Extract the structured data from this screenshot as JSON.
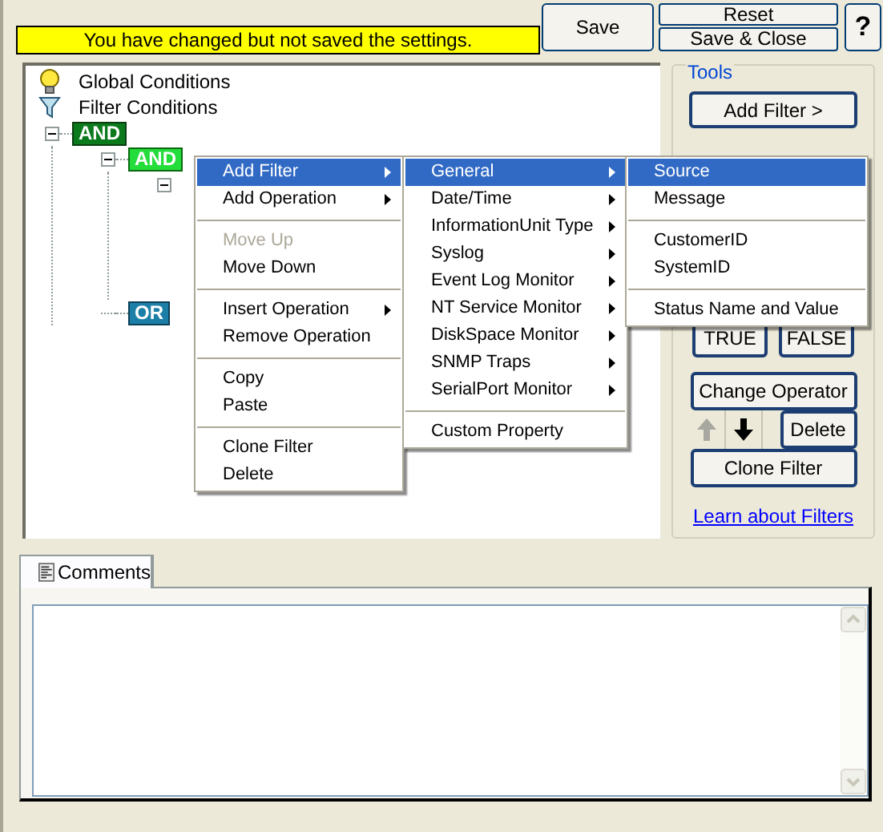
{
  "header": {
    "notice": "You have changed but not saved the settings.",
    "save": "Save",
    "reset": "Reset",
    "save_close": "Save & Close",
    "help": "?"
  },
  "tree": {
    "roots": [
      {
        "kind": "global",
        "label": "Global Conditions"
      },
      {
        "kind": "filter",
        "label": "Filter Conditions"
      }
    ],
    "operators": [
      {
        "kind": "and",
        "label": "AND",
        "expanded": true,
        "selected": false,
        "children": [
          {
            "kind": "and",
            "label": "AND",
            "expanded": true,
            "selected": true,
            "children": [
              {
                "kind": "hidden",
                "expanded": true
              }
            ]
          },
          {
            "kind": "or",
            "label": "OR",
            "selected": false
          }
        ]
      }
    ]
  },
  "tools": {
    "title": "Tools",
    "add_filter": "Add Filter >",
    "true_label": "TRUE",
    "false_label": "FALSE",
    "change_operator": "Change Operator",
    "arrows": [
      {
        "kind": "up",
        "disabled": true
      },
      {
        "kind": "down",
        "disabled": false
      }
    ],
    "delete": "Delete",
    "clone_filter": "Clone Filter",
    "link": "Learn about Filters"
  },
  "comments": {
    "tab": {
      "label": "Comments",
      "selected": true
    }
  },
  "menus": [
    {
      "items": [
        {
          "kind": "item",
          "label": "Add Filter",
          "submenu": true,
          "selected": true,
          "disabled": false
        },
        {
          "kind": "item",
          "label": "Add Operation",
          "submenu": true,
          "selected": false,
          "disabled": false
        },
        {
          "kind": "separator"
        },
        {
          "kind": "item",
          "label": "Move Up",
          "submenu": false,
          "selected": false,
          "disabled": true
        },
        {
          "kind": "item",
          "label": "Move Down",
          "submenu": false,
          "selected": false,
          "disabled": false
        },
        {
          "kind": "separator"
        },
        {
          "kind": "item",
          "label": "Insert Operation",
          "submenu": true,
          "selected": false,
          "disabled": false
        },
        {
          "kind": "item",
          "label": "Remove Operation",
          "submenu": false,
          "selected": false,
          "disabled": false
        },
        {
          "kind": "separator"
        },
        {
          "kind": "item",
          "label": "Copy",
          "submenu": false,
          "selected": false,
          "disabled": false
        },
        {
          "kind": "item",
          "label": "Paste",
          "submenu": false,
          "selected": false,
          "disabled": false
        },
        {
          "kind": "separator"
        },
        {
          "kind": "item",
          "label": "Clone Filter",
          "submenu": false,
          "selected": false,
          "disabled": false
        },
        {
          "kind": "item",
          "label": "Delete",
          "submenu": false,
          "selected": false,
          "disabled": false
        }
      ]
    },
    {
      "items": [
        {
          "kind": "item",
          "label": "General",
          "submenu": true,
          "selected": true,
          "disabled": false
        },
        {
          "kind": "item",
          "label": "Date/Time",
          "submenu": true,
          "selected": false,
          "disabled": false
        },
        {
          "kind": "item",
          "label": "InformationUnit Type",
          "submenu": true,
          "selected": false,
          "disabled": false
        },
        {
          "kind": "item",
          "label": "Syslog",
          "submenu": true,
          "selected": false,
          "disabled": false
        },
        {
          "kind": "item",
          "label": "Event Log Monitor",
          "submenu": true,
          "selected": false,
          "disabled": false
        },
        {
          "kind": "item",
          "label": "NT Service Monitor",
          "submenu": true,
          "selected": false,
          "disabled": false
        },
        {
          "kind": "item",
          "label": "DiskSpace Monitor",
          "submenu": true,
          "selected": false,
          "disabled": false
        },
        {
          "kind": "item",
          "label": "SNMP Traps",
          "submenu": true,
          "selected": false,
          "disabled": false
        },
        {
          "kind": "item",
          "label": "SerialPort Monitor",
          "submenu": true,
          "selected": false,
          "disabled": false
        },
        {
          "kind": "separator"
        },
        {
          "kind": "item",
          "label": "Custom Property",
          "submenu": false,
          "selected": false,
          "disabled": false
        }
      ]
    },
    {
      "items": [
        {
          "kind": "item",
          "label": "Source",
          "submenu": false,
          "selected": true,
          "disabled": false
        },
        {
          "kind": "item",
          "label": "Message",
          "submenu": false,
          "selected": false,
          "disabled": false
        },
        {
          "kind": "separator"
        },
        {
          "kind": "item",
          "label": "CustomerID",
          "submenu": false,
          "selected": false,
          "disabled": false
        },
        {
          "kind": "item",
          "label": "SystemID",
          "submenu": false,
          "selected": false,
          "disabled": false
        },
        {
          "kind": "separator"
        },
        {
          "kind": "item",
          "label": "Status Name and Value",
          "submenu": false,
          "selected": false,
          "disabled": false
        }
      ]
    }
  ]
}
